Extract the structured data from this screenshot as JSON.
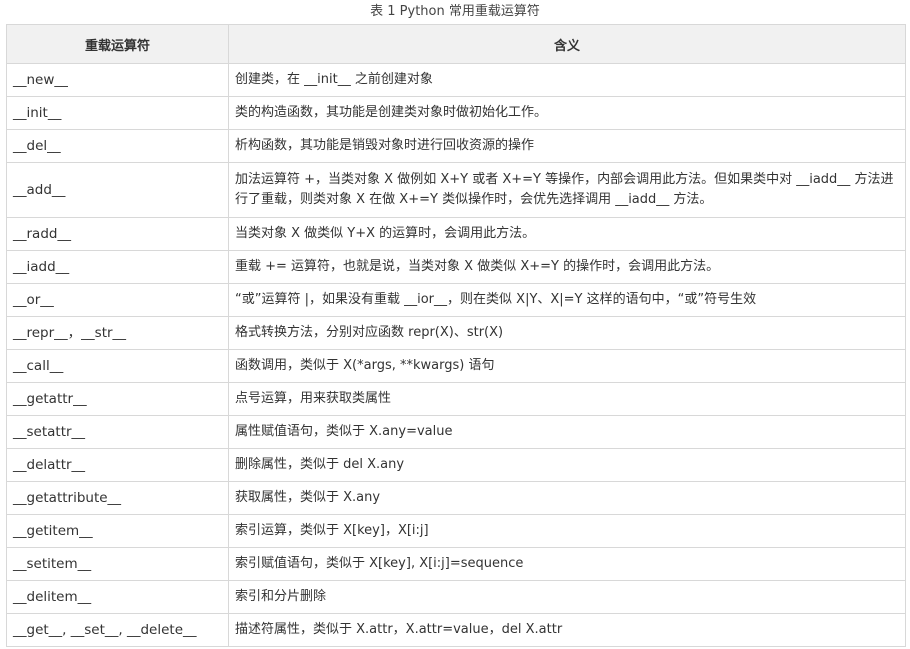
{
  "caption": "表 1 Python 常用重载运算符",
  "table": {
    "headers": [
      "重载运算符",
      "含义"
    ],
    "rows": [
      {
        "op": "__new__",
        "desc": "创建类，在 __init__ 之前创建对象"
      },
      {
        "op": "__init__",
        "desc": "类的构造函数，其功能是创建类对象时做初始化工作。"
      },
      {
        "op": "__del__",
        "desc": "析构函数，其功能是销毁对象时进行回收资源的操作"
      },
      {
        "op": "__add__",
        "desc": "加法运算符 +，当类对象 X 做例如 X+Y 或者 X+=Y 等操作，内部会调用此方法。但如果类中对 __iadd__ 方法进行了重载，则类对象 X 在做 X+=Y 类似操作时，会优先选择调用 __iadd__ 方法。"
      },
      {
        "op": "__radd__",
        "desc": "当类对象 X 做类似 Y+X 的运算时，会调用此方法。"
      },
      {
        "op": "__iadd__",
        "desc": "重载 += 运算符，也就是说，当类对象 X 做类似 X+=Y 的操作时，会调用此方法。"
      },
      {
        "op": "__or__",
        "desc": "“或”运算符 |，如果没有重载 __ior__，则在类似 X|Y、X|=Y 这样的语句中，“或”符号生效"
      },
      {
        "op": "__repr__，__str__",
        "desc": "格式转换方法，分别对应函数 repr(X)、str(X)"
      },
      {
        "op": "__call__",
        "desc": "函数调用，类似于 X(*args, **kwargs) 语句"
      },
      {
        "op": "__getattr__",
        "desc": "点号运算，用来获取类属性"
      },
      {
        "op": "__setattr__",
        "desc": "属性赋值语句，类似于 X.any=value"
      },
      {
        "op": "__delattr__",
        "desc": "删除属性，类似于 del X.any"
      },
      {
        "op": "__getattribute__",
        "desc": "获取属性，类似于 X.any"
      },
      {
        "op": "__getitem__",
        "desc": "索引运算，类似于 X[key]，X[i:j]"
      },
      {
        "op": "__setitem__",
        "desc": "索引赋值语句，类似于 X[key], X[i:j]=sequence"
      },
      {
        "op": "__delitem__",
        "desc": "索引和分片删除"
      },
      {
        "op": "__get__, __set__, __delete__",
        "desc": "描述符属性，类似于 X.attr，X.attr=value，del X.attr"
      }
    ]
  }
}
